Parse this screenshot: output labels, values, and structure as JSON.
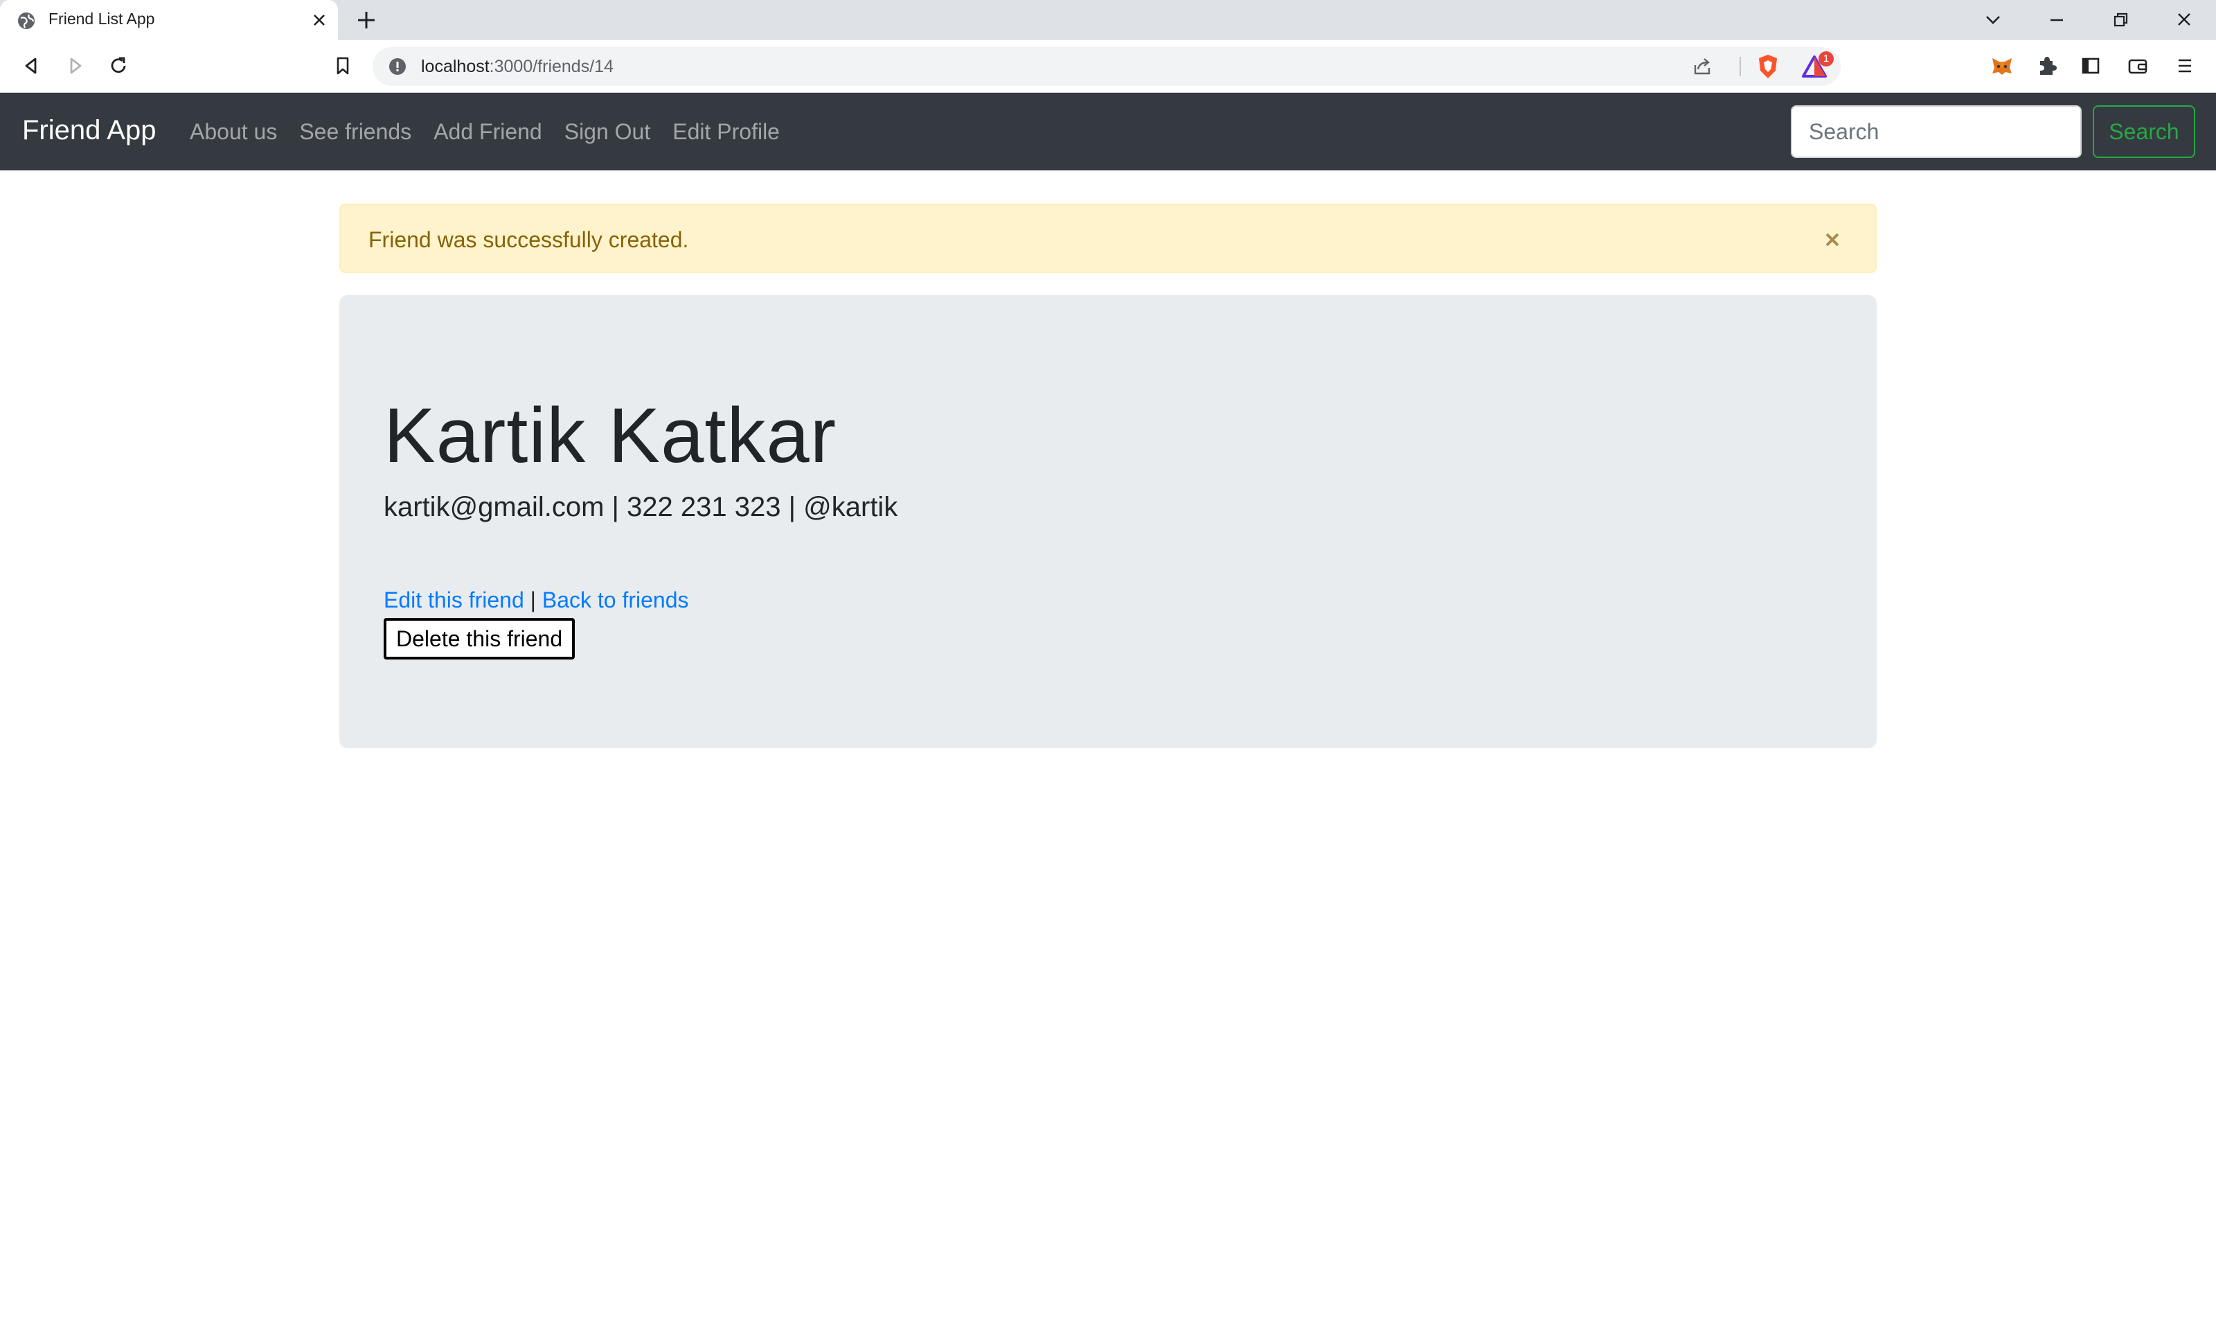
{
  "browser": {
    "tab_title": "Friend List App",
    "url_host": "localhost",
    "url_path": ":3000/friends/14",
    "rewards_badge": "1"
  },
  "navbar": {
    "brand": "Friend App",
    "links": [
      "About us",
      "See friends",
      "Add Friend",
      "Sign Out",
      "Edit Profile"
    ],
    "search_placeholder": "Search",
    "search_button": "Search"
  },
  "alert": {
    "message": "Friend was successfully created."
  },
  "friend": {
    "name": "Kartik Katkar",
    "email": "kartik@gmail.com",
    "phone": "322 231 323",
    "twitter": "@kartik",
    "separator": " | "
  },
  "actions": {
    "edit_label": "Edit this friend",
    "back_label": "Back to friends",
    "delete_label": "Delete this friend"
  },
  "colors": {
    "navbar_bg": "#343a40",
    "alert_bg": "#fff3cd",
    "alert_text": "#856404",
    "jumbotron_bg": "#e9ecef",
    "link": "#007bff",
    "success": "#28a745"
  }
}
